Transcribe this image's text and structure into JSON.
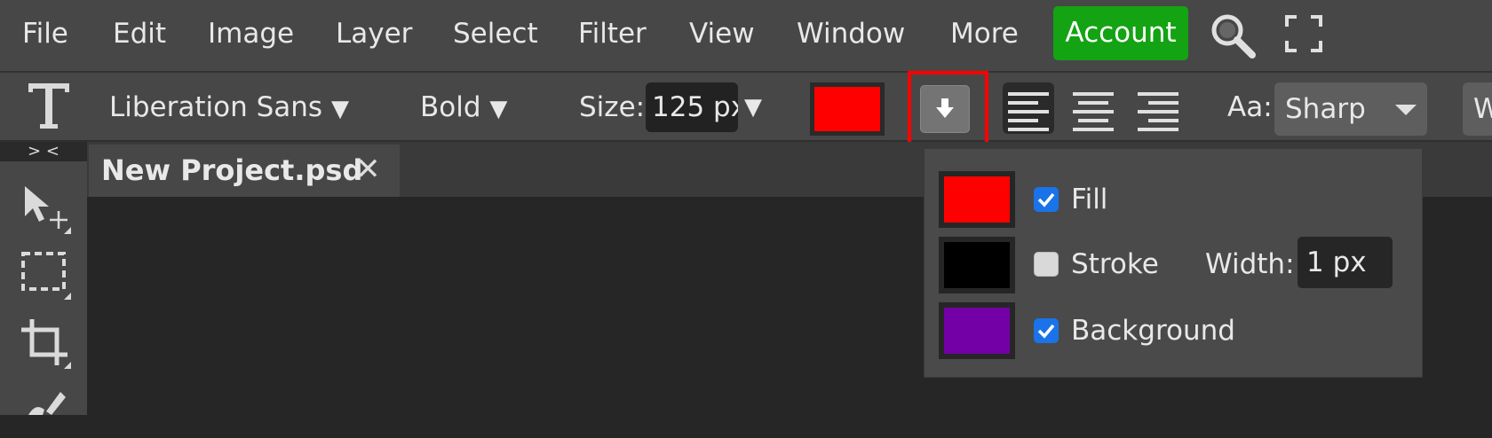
{
  "menu": {
    "items": [
      "File",
      "Edit",
      "Image",
      "Layer",
      "Select",
      "Filter",
      "View",
      "Window",
      "More"
    ],
    "account_label": "Account"
  },
  "options": {
    "font_family": "Liberation Sans",
    "font_weight": "Bold",
    "size_label": "Size:",
    "size_value": "125 px",
    "text_color": "#ff0000",
    "aa_label": "Aa:",
    "aa_value": "Sharp",
    "next_cut": "W"
  },
  "collapse_glyph": "> <",
  "tab": {
    "title": "New Project.psd",
    "close_glyph": "✕"
  },
  "popover": {
    "fill": {
      "label": "Fill",
      "color": "#ff0000",
      "checked": true
    },
    "stroke": {
      "label": "Stroke",
      "color": "#000000",
      "checked": false,
      "width_label": "Width:",
      "width_value": "1 px"
    },
    "background": {
      "label": "Background",
      "color": "#7300a6",
      "checked": true
    }
  }
}
